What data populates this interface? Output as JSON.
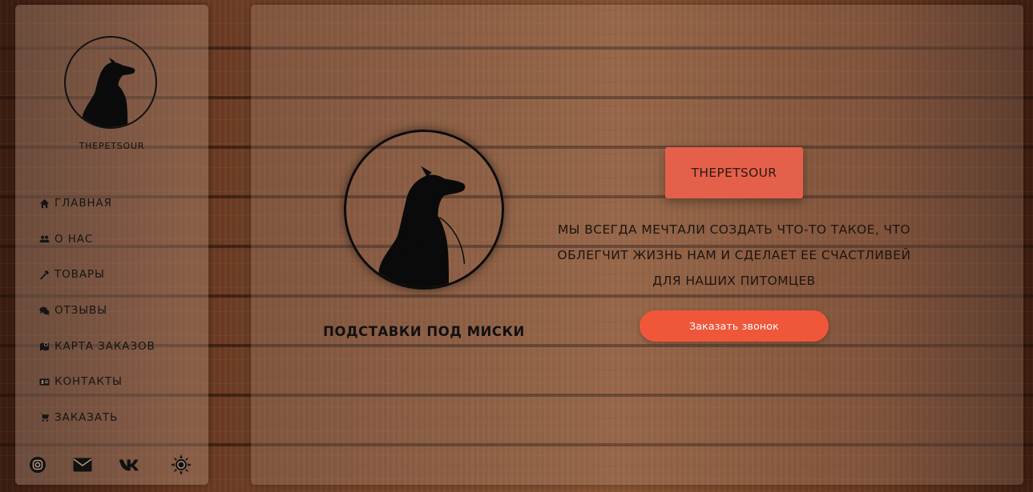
{
  "sidebar": {
    "logo": {
      "icon": "dog-cat-silhouette-icon"
    },
    "brand_name": "THEPETSOUR",
    "nav": [
      {
        "icon": "home-icon",
        "label": "ГЛАВНАЯ"
      },
      {
        "icon": "users-icon",
        "label": "О НАС"
      },
      {
        "icon": "hammer-icon",
        "label": "ТОВАРЫ"
      },
      {
        "icon": "chat-bubbles-icon",
        "label": "ОТЗЫВЫ"
      },
      {
        "icon": "map-icon",
        "label": "КАРТА ЗАКАЗОВ"
      },
      {
        "icon": "id-card-icon",
        "label": "КОНТАКТЫ"
      },
      {
        "icon": "cart-icon",
        "label": "ЗАКАЗАТЬ"
      }
    ],
    "social": [
      {
        "icon": "instagram-icon"
      },
      {
        "icon": "envelope-icon"
      },
      {
        "icon": "vk-icon"
      },
      {
        "icon": "sun-theme-icon"
      }
    ]
  },
  "main": {
    "hero_image": {
      "icon": "dog-cat-silhouette-icon"
    },
    "hero_caption": "ПОДСТАВКИ ПОД МИСКИ",
    "brand_badge": "THEPETSOUR",
    "tagline_lines": [
      "МЫ ВСЕГДА МЕЧТАЛИ СОЗДАТЬ ЧТО-ТО ТАКОЕ, ЧТО",
      "ОБЛЕГЧИТ ЖИЗНЬ НАМ И СДЕЛАЕТ ЕЕ СЧАСТЛИВЕЙ",
      "ДЛЯ НАШИХ ПИТОМЦЕВ"
    ],
    "cta_label": "Заказать звонок"
  },
  "colors": {
    "accent": "#f0573a",
    "badge": "#e5604a",
    "text_dark": "#151515"
  }
}
